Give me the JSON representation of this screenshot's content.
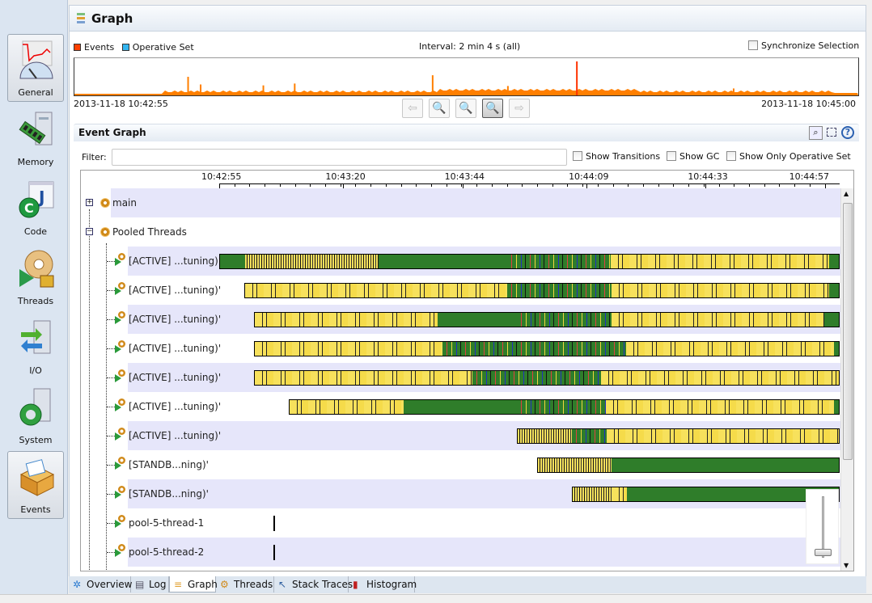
{
  "sidebar": {
    "items": [
      {
        "label": "General",
        "icon": "general-gauge-icon",
        "selected": true
      },
      {
        "label": "Memory",
        "icon": "memory-icon",
        "selected": false
      },
      {
        "label": "Code",
        "icon": "code-icon",
        "selected": false
      },
      {
        "label": "Threads",
        "icon": "threads-icon",
        "selected": false
      },
      {
        "label": "I/O",
        "icon": "io-icon",
        "selected": false
      },
      {
        "label": "System",
        "icon": "system-icon",
        "selected": false
      },
      {
        "label": "Events",
        "icon": "events-icon",
        "selected": true
      }
    ]
  },
  "header": {
    "title": "Graph",
    "icon": "graph-icon"
  },
  "overview": {
    "legend": [
      {
        "label": "Events",
        "color": "#ff4000"
      },
      {
        "label": "Operative Set",
        "color": "#33b5f0"
      }
    ],
    "interval": "Interval: 2 min 4 s (all)",
    "sync_label": "Synchronize Selection",
    "sync_checked": false,
    "start": "2013-11-18 10:42:55",
    "end": "2013-11-18 10:45:00",
    "series_color": "#ff7f00",
    "spike_color": "#ff3300",
    "spikes": [
      [
        "10:43:13",
        0.5
      ],
      [
        "10:43:15",
        0.25
      ],
      [
        "10:43:25",
        0.22
      ],
      [
        "10:43:30",
        0.28
      ],
      [
        "10:43:52",
        0.55
      ],
      [
        "10:44:04",
        0.2
      ],
      [
        "10:44:15",
        1.0
      ],
      [
        "10:44:40",
        0.12
      ]
    ],
    "buttons": [
      {
        "name": "back",
        "icon": "arrow-left-icon",
        "enabled": false
      },
      {
        "name": "zoom-out",
        "icon": "zoom-out-icon",
        "enabled": false
      },
      {
        "name": "zoom-fit",
        "icon": "zoom-selection-icon",
        "enabled": false
      },
      {
        "name": "zoom-in",
        "icon": "zoom-in-icon",
        "enabled": true
      },
      {
        "name": "forward",
        "icon": "arrow-right-icon",
        "enabled": false
      }
    ]
  },
  "event_graph": {
    "title": "Event Graph",
    "filter_label": "Filter:",
    "filter_value": "",
    "options": [
      {
        "label": "Show Transitions",
        "checked": false
      },
      {
        "label": "Show GC",
        "checked": false
      },
      {
        "label": "Show Only Operative Set",
        "checked": false
      }
    ],
    "axis_start": "10:42:55",
    "axis_end": "10:45:00",
    "ticks": [
      "10:42:55",
      "10:43:20",
      "10:43:44",
      "10:44:09",
      "10:44:33",
      "10:44:57"
    ],
    "state_colors": {
      "run": "#2f7d2a",
      "wait": "#f7e15c"
    },
    "groups": [
      {
        "label": "main",
        "expanded": false
      },
      {
        "label": "Pooled Threads",
        "expanded": true
      }
    ],
    "threads": [
      {
        "label": "[ACTIVE] ...tuning)'",
        "segments": [
          [
            "10:42:55",
            "10:43:00",
            "run"
          ],
          [
            "10:43:00",
            "10:43:27",
            "dense"
          ],
          [
            "10:43:27",
            "10:43:53",
            "run"
          ],
          [
            "10:43:53",
            "10:44:14",
            "mixed"
          ],
          [
            "10:44:14",
            "10:44:58",
            "wait"
          ],
          [
            "10:44:58",
            "10:45:00",
            "run"
          ]
        ]
      },
      {
        "label": "[ACTIVE] ...tuning)'",
        "segments": [
          [
            "10:43:00",
            "10:43:53",
            "wait"
          ],
          [
            "10:43:53",
            "10:44:14",
            "mixed"
          ],
          [
            "10:44:14",
            "10:44:58",
            "wait"
          ],
          [
            "10:44:58",
            "10:45:00",
            "run"
          ]
        ]
      },
      {
        "label": "[ACTIVE] ...tuning)'",
        "segments": [
          [
            "10:43:02",
            "10:43:39",
            "wait"
          ],
          [
            "10:43:39",
            "10:43:55",
            "run"
          ],
          [
            "10:43:55",
            "10:44:14",
            "mixed"
          ],
          [
            "10:44:14",
            "10:44:57",
            "wait"
          ],
          [
            "10:44:57",
            "10:45:00",
            "run"
          ]
        ]
      },
      {
        "label": "[ACTIVE] ...tuning)'",
        "segments": [
          [
            "10:43:02",
            "10:43:40",
            "wait"
          ],
          [
            "10:43:40",
            "10:44:17",
            "mixed"
          ],
          [
            "10:44:17",
            "10:44:59",
            "wait"
          ],
          [
            "10:44:59",
            "10:45:00",
            "run"
          ]
        ]
      },
      {
        "label": "[ACTIVE] ...tuning)'",
        "segments": [
          [
            "10:43:02",
            "10:43:46",
            "wait"
          ],
          [
            "10:43:46",
            "10:44:12",
            "mixed"
          ],
          [
            "10:44:12",
            "10:45:00",
            "wait"
          ]
        ]
      },
      {
        "label": "[ACTIVE] ...tuning)'",
        "segments": [
          [
            "10:43:09",
            "10:43:32",
            "wait"
          ],
          [
            "10:43:32",
            "10:43:55",
            "run"
          ],
          [
            "10:43:55",
            "10:44:13",
            "mixed"
          ],
          [
            "10:44:13",
            "10:44:59",
            "wait"
          ],
          [
            "10:44:59",
            "10:45:00",
            "run"
          ]
        ]
      },
      {
        "label": "[ACTIVE] ...tuning)'",
        "segments": [
          [
            "10:43:55",
            "10:44:06",
            "dense"
          ],
          [
            "10:44:06",
            "10:44:13",
            "mixed"
          ],
          [
            "10:44:13",
            "10:45:00",
            "wait"
          ]
        ]
      },
      {
        "label": "[STANDB...ning)'",
        "segments": [
          [
            "10:43:59",
            "10:44:14",
            "dense"
          ],
          [
            "10:44:14",
            "10:45:00",
            "run"
          ]
        ]
      },
      {
        "label": "[STANDB...ning)'",
        "segments": [
          [
            "10:44:06",
            "10:44:14",
            "dense"
          ],
          [
            "10:44:14",
            "10:44:17",
            "wait"
          ],
          [
            "10:44:17",
            "10:45:00",
            "run"
          ]
        ]
      },
      {
        "label": "pool-5-thread-1",
        "marker": "10:43:06"
      },
      {
        "label": "pool-5-thread-2",
        "marker": "10:43:06"
      }
    ],
    "zoom_slider_level": 0.1
  },
  "bottom_tabs": [
    {
      "label": "Overview",
      "icon": "overview-icon",
      "selected": false
    },
    {
      "label": "Log",
      "icon": "log-icon",
      "selected": false
    },
    {
      "label": "Graph",
      "icon": "graph-icon",
      "selected": true
    },
    {
      "label": "Threads",
      "icon": "threads-icon",
      "selected": false
    },
    {
      "label": "Stack Traces",
      "icon": "stack-traces-icon",
      "selected": false
    },
    {
      "label": "Histogram",
      "icon": "histogram-icon",
      "selected": false
    }
  ]
}
